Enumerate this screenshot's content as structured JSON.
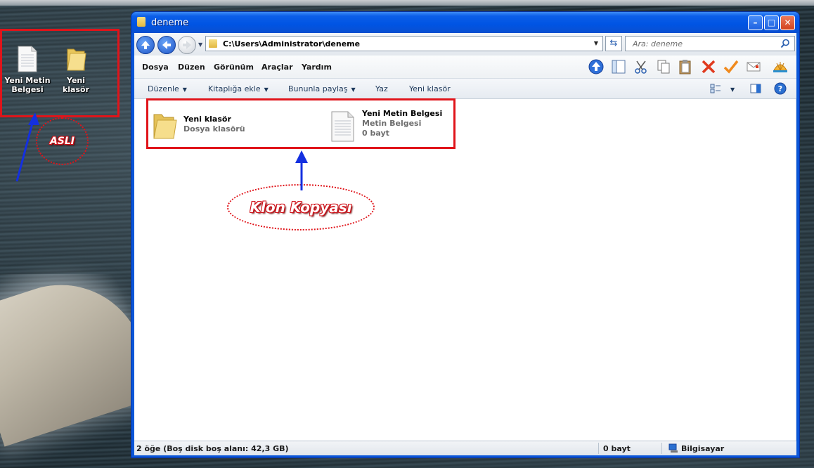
{
  "desktop": {
    "icons": [
      {
        "label": "Yeni Metin Belgesi",
        "icon": "text-document-icon"
      },
      {
        "label": "Yeni klasör",
        "icon": "folder-icon"
      }
    ],
    "annotation_original": "ASLI",
    "annotation_clone": "Klon Kopyası"
  },
  "window": {
    "title": "deneme",
    "address": "C:\\Users\\Administrator\\deneme",
    "search_placeholder": "Ara: deneme",
    "menu": [
      "Dosya",
      "Düzen",
      "Görünüm",
      "Araçlar",
      "Yardım"
    ],
    "commands": [
      "Düzenle",
      "Kitaplığa ekle",
      "Bununla paylaş",
      "Yaz",
      "Yeni klasör"
    ],
    "items": [
      {
        "name": "Yeni klasör",
        "type": "Dosya klasörü",
        "size": "",
        "icon": "folder-icon"
      },
      {
        "name": "Yeni Metin Belgesi",
        "type": "Metin Belgesi",
        "size": "0 bayt",
        "icon": "text-document-icon"
      }
    ],
    "status": {
      "items": "2 öğe (Boş disk boş alanı: 42,3 GB)",
      "size": "0 bayt",
      "location": "Bilgisayar"
    }
  },
  "colors": {
    "annotation_red": "#e0141a",
    "arrow_blue": "#1430e0",
    "xp_title_blue": "#0054e3"
  }
}
